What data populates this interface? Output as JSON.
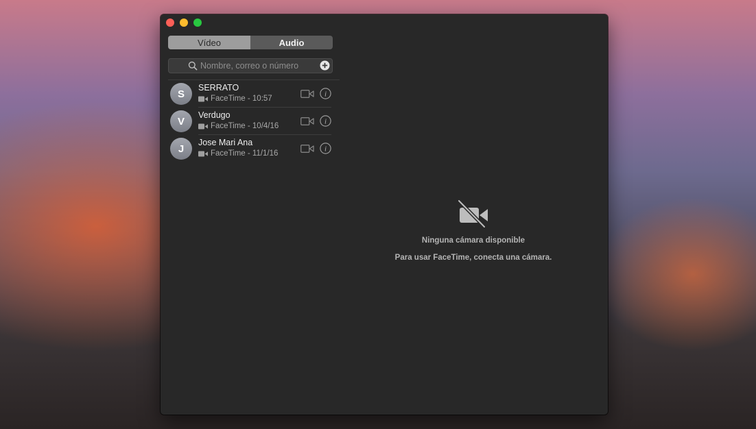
{
  "window": {
    "tabs": [
      {
        "label": "Vídeo",
        "selected": false
      },
      {
        "label": "Audio",
        "selected": true
      }
    ],
    "search": {
      "placeholder": "Nombre, correo o número",
      "value": ""
    }
  },
  "contacts": [
    {
      "initial": "S",
      "name": "SERRATO",
      "detail": "FaceTime - 10:57"
    },
    {
      "initial": "V",
      "name": "Verdugo",
      "detail": "FaceTime - 10/4/16"
    },
    {
      "initial": "J",
      "name": "Jose Mari Ana",
      "detail": "FaceTime - 11/1/16"
    }
  ],
  "no_camera": {
    "title": "Ninguna cámara disponible",
    "message": "Para usar FaceTime, conecta una cámara."
  },
  "icons": {
    "search": "search-icon",
    "add": "add-contact-icon",
    "video_call": "video-camera-icon",
    "info": "info-icon",
    "no_camera": "camera-off-icon"
  },
  "colors": {
    "close": "#fd5f57",
    "minimize": "#febc2e",
    "zoom": "#28c840",
    "window_bg": "#282828"
  }
}
